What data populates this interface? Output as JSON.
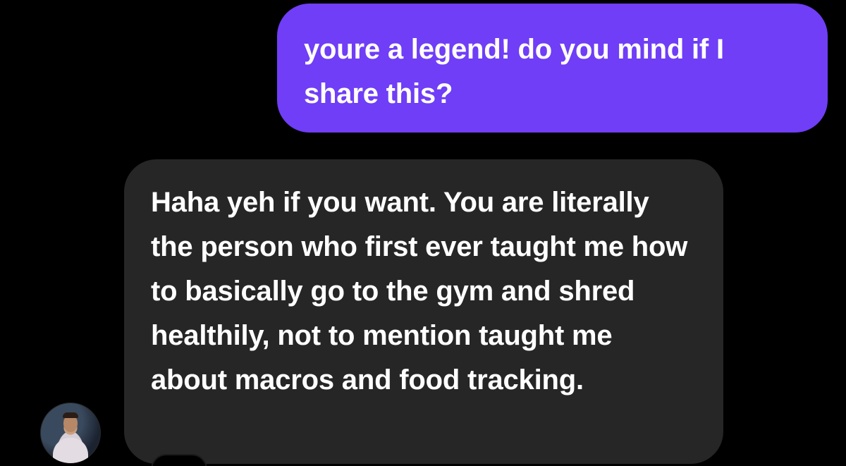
{
  "messages": [
    {
      "direction": "outgoing",
      "text": "youre a legend! do you mind if I share this?"
    },
    {
      "direction": "incoming",
      "text": "Haha yeh if you want. You are literally the person who first ever taught me how to basically go to the gym and shred healthily, not to mention taught me about macros and food tracking."
    }
  ],
  "colors": {
    "background": "#000000",
    "outgoing_bubble": "#6f3ef6",
    "incoming_bubble": "#262626",
    "text": "#ffffff"
  },
  "icons": {
    "sender_avatar": "avatar"
  }
}
